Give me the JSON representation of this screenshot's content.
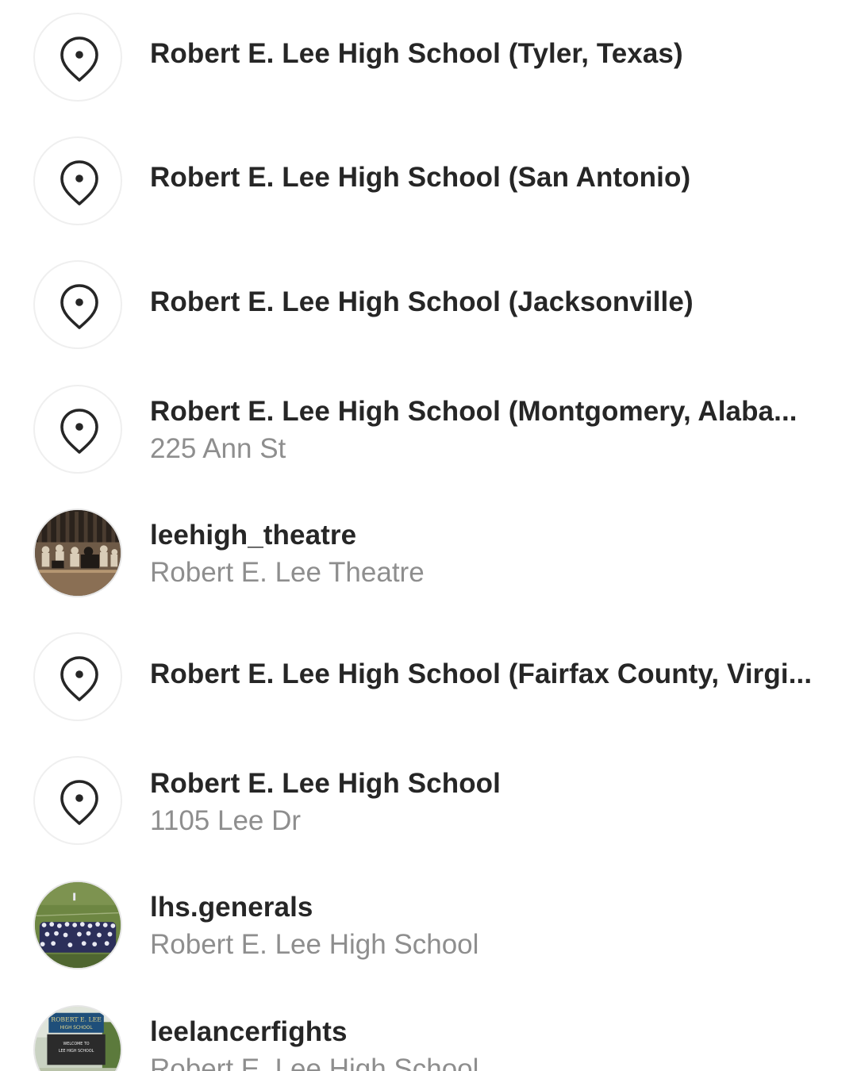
{
  "results": [
    {
      "kind": "place",
      "icon": "location-pin-icon",
      "title": "Robert E. Lee High School (Tyler, Texas)"
    },
    {
      "kind": "place",
      "icon": "location-pin-icon",
      "title": "Robert E. Lee High School (San Antonio)"
    },
    {
      "kind": "place",
      "icon": "location-pin-icon",
      "title": "Robert E. Lee High School (Jacksonville)"
    },
    {
      "kind": "place",
      "icon": "location-pin-icon",
      "title": "Robert E. Lee High School (Montgomery, Alaba...",
      "subtitle": "225 Ann St"
    },
    {
      "kind": "account",
      "avatar": "theatre-stage-photo",
      "title": "leehigh_theatre",
      "subtitle": "Robert E. Lee Theatre"
    },
    {
      "kind": "place",
      "icon": "location-pin-icon",
      "title": "Robert E. Lee High School (Fairfax County, Virgi..."
    },
    {
      "kind": "place",
      "icon": "location-pin-icon",
      "title": "Robert E. Lee High School",
      "subtitle": "1105 Lee Dr"
    },
    {
      "kind": "account",
      "avatar": "marching-band-photo",
      "title": "lhs.generals",
      "subtitle": "Robert E. Lee High School"
    },
    {
      "kind": "account",
      "avatar": "school-sign-photo",
      "title": "leelancerfights",
      "subtitle": "Robert E. Lee High School"
    }
  ],
  "avatar_sign": {
    "line1": "ROBERT E. LEE",
    "line2": "HIGH SCHOOL",
    "line3": "WELCOME TO",
    "line4": "LEE HIGH SCHOOL"
  },
  "colors": {
    "title": "#262626",
    "subtitle": "#8e8e8e",
    "icon": "#262626",
    "avatar_border": "#efefef",
    "background": "#ffffff"
  }
}
